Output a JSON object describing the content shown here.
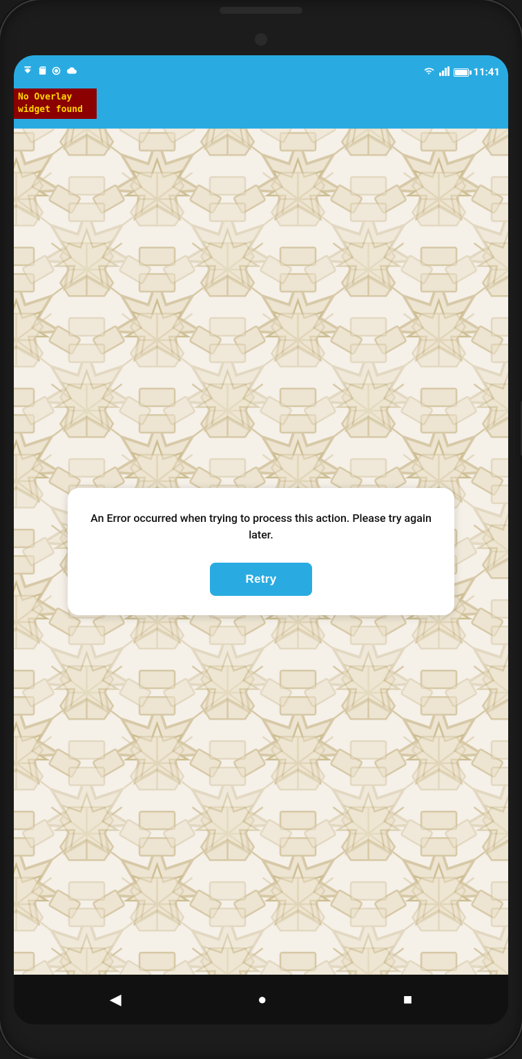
{
  "phone": {
    "status_bar": {
      "time": "11:41",
      "icons_left": [
        "download-icon",
        "sd-card-icon",
        "sync-icon",
        "cloud-icon"
      ]
    },
    "overlay_badge": {
      "text": "No Overlay widget found"
    },
    "error_card": {
      "message": "An Error occurred when trying to process this action. Please try again later.",
      "retry_label": "Retry"
    },
    "nav_bar": {
      "back_label": "◀",
      "home_label": "●",
      "recent_label": "■"
    }
  }
}
